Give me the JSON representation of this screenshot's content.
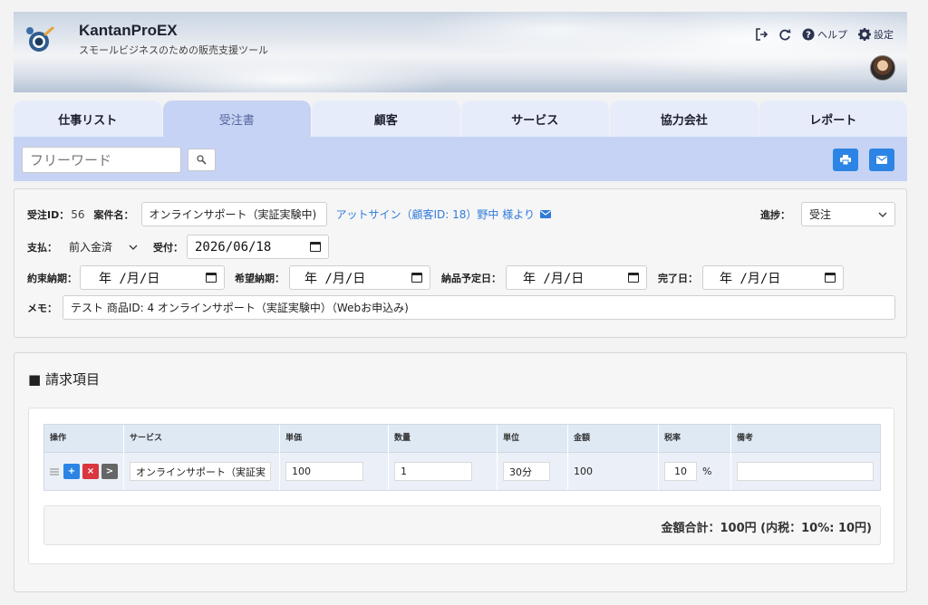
{
  "app": {
    "title": "KantanProEX",
    "subtitle": "スモールビジネスのための販売支援ツール"
  },
  "header_tools": {
    "help_label": "ヘルプ",
    "settings_label": "設定"
  },
  "tabs": [
    {
      "label": "仕事リスト",
      "active": false
    },
    {
      "label": "受注書",
      "active": true
    },
    {
      "label": "顧客",
      "active": false
    },
    {
      "label": "サービス",
      "active": false
    },
    {
      "label": "協力会社",
      "active": false
    },
    {
      "label": "レポート",
      "active": false
    }
  ],
  "search": {
    "placeholder": "フリーワード"
  },
  "order": {
    "id_label": "受注ID：",
    "id_value": "56",
    "case_label": "案件名：",
    "case_value": "オンラインサポート（実証実験中)",
    "customer_link": "アットサイン（顧客ID: 18）野中 様より",
    "progress_label": "進捗：",
    "progress_value": "受注",
    "payment_label": "支払：",
    "payment_value": "前入金済",
    "received_label": "受付：",
    "received_value": "2026/06/18",
    "promised_label": "約束納期：",
    "promised_value": "年 /月/日",
    "desired_label": "希望納期：",
    "desired_value": "年 /月/日",
    "scheduled_label": "納品予定日：",
    "scheduled_value": "年 /月/日",
    "completed_label": "完了日：",
    "completed_value": "年 /月/日",
    "memo_label": "メモ：",
    "memo_value": "テスト 商品ID: 4 オンラインサポート（実証実験中）（Webお申込み)"
  },
  "billing": {
    "title": "■ 請求項目",
    "columns": [
      "操作",
      "サービス",
      "単価",
      "数量",
      "単位",
      "金額",
      "税率",
      "備考"
    ],
    "rows": [
      {
        "service": "オンラインサポート（実証実",
        "price": "100",
        "qty": "1",
        "unit": "30分",
        "amount": "100",
        "tax": "10",
        "tax_unit": "%",
        "note": ""
      }
    ],
    "row_buttons": {
      "add": "+",
      "remove": "×",
      "more": ">"
    },
    "total": "金額合計：100円 (内税：10%: 10円)"
  },
  "colors": {
    "accent": "#2c85e4",
    "tab_active": "#c6d3f4",
    "tab_inactive": "#e7ecfb",
    "link": "#2f7ad9",
    "delete": "#d9363e"
  }
}
